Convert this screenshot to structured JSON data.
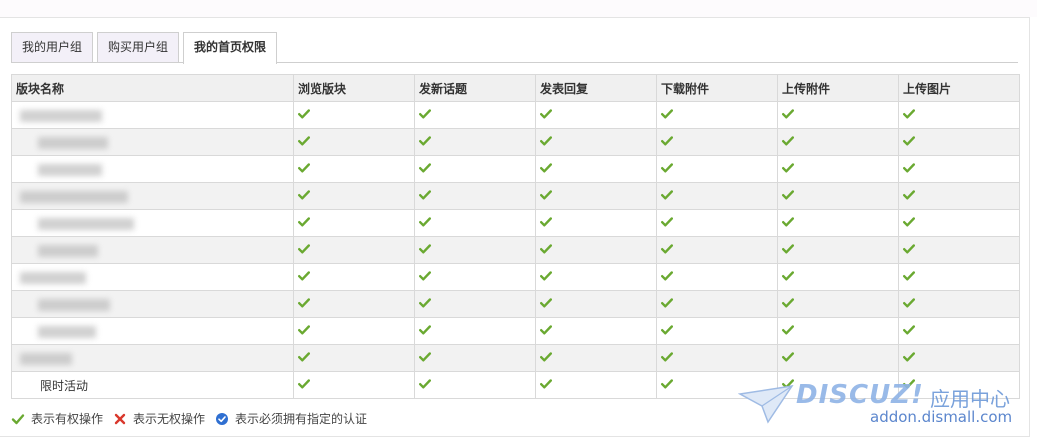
{
  "tabs": [
    {
      "label": "我的用户组",
      "active": false
    },
    {
      "label": "购买用户组",
      "active": false
    },
    {
      "label": "我的首页权限",
      "active": true
    }
  ],
  "table": {
    "headers": [
      "版块名称",
      "浏览版块",
      "发新话题",
      "发表回复",
      "下载附件",
      "上传附件",
      "上传图片"
    ],
    "rows": [
      {
        "name": "",
        "perms": [
          "check",
          "check",
          "check",
          "check",
          "check",
          "check"
        ]
      },
      {
        "name": "",
        "perms": [
          "check",
          "check",
          "check",
          "check",
          "check",
          "check"
        ]
      },
      {
        "name": "",
        "perms": [
          "check",
          "check",
          "check",
          "check",
          "check",
          "check"
        ]
      },
      {
        "name": "",
        "perms": [
          "check",
          "check",
          "check",
          "check",
          "check",
          "check"
        ]
      },
      {
        "name": "",
        "perms": [
          "check",
          "check",
          "check",
          "check",
          "check",
          "check"
        ]
      },
      {
        "name": "",
        "perms": [
          "check",
          "check",
          "check",
          "check",
          "check",
          "check"
        ]
      },
      {
        "name": "",
        "perms": [
          "check",
          "check",
          "check",
          "check",
          "check",
          "check"
        ]
      },
      {
        "name": "",
        "perms": [
          "check",
          "check",
          "check",
          "check",
          "check",
          "check"
        ]
      },
      {
        "name": "",
        "perms": [
          "check",
          "check",
          "check",
          "check",
          "check",
          "check"
        ]
      },
      {
        "name": "",
        "perms": [
          "check",
          "check",
          "check",
          "check",
          "check",
          "check"
        ]
      },
      {
        "name": "限时活动",
        "perms": [
          "check",
          "check",
          "check",
          "check",
          "check",
          "check"
        ]
      }
    ]
  },
  "legend": {
    "allowed": "表示有权操作",
    "denied": "表示无权操作",
    "verify": "表示必须拥有指定的认证"
  },
  "watermark": {
    "brand": "DISCUZ!",
    "cn": "应用中心",
    "url": "addon.dismall.com"
  },
  "colors": {
    "check": "#6aa931",
    "cross": "#d9382c",
    "verify": "#2f6fd1",
    "tab_bg": "#f3f0f8",
    "header_bg": "#f0f0f0"
  }
}
